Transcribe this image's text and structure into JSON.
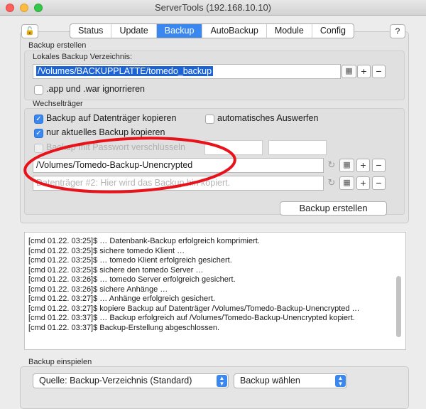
{
  "window": {
    "title": "ServerTools (192.168.10.10)"
  },
  "toolbar": {
    "lock_glyph": "🔓",
    "help_label": "?",
    "tabs": [
      {
        "label": "Status"
      },
      {
        "label": "Update"
      },
      {
        "label": "Backup",
        "active": true
      },
      {
        "label": "AutoBackup"
      },
      {
        "label": "Module"
      },
      {
        "label": "Config"
      }
    ]
  },
  "backup": {
    "section_label": "Backup erstellen",
    "local_dir_label": "Lokales Backup Verzeichnis:",
    "local_dir_value": "/Volumes/BACKUPPLATTE/tomedo_backup",
    "ignore_label": ".app und .war ignorrieren",
    "ignore_checked": false,
    "media_section_label": "Wechselträger",
    "copy_media_label": "Backup auf Datenträger kopieren",
    "copy_media_checked": true,
    "auto_eject_label": "automatisches Auswerfen",
    "auto_eject_checked": false,
    "current_only_label": "nur aktuelles Backup kopieren",
    "current_only_checked": true,
    "password_label": "Backup mit Passwort verschlüsseln",
    "password_checked": false,
    "media1_value": "/Volumes/Tomedo-Backup-Unencrypted",
    "media2_placeholder": "Datenträger #2: Hier wird das Backup hin kopiert.",
    "create_button": "Backup erstellen",
    "plus": "+",
    "minus": "−"
  },
  "log": {
    "lines": [
      "[cmd 01.22. 03:25]$ … Datenbank-Backup erfolgreich komprimiert.",
      "[cmd 01.22. 03:25]$ sichere tomedo Klient …",
      "[cmd 01.22. 03:25]$ … tomedo Klient erfolgreich gesichert.",
      "[cmd 01.22. 03:25]$ sichere den tomedo Server …",
      "[cmd 01.22. 03:26]$ … tomedo Server erfolgreich gesichert.",
      "[cmd 01.22. 03:26]$ sichere Anhänge …",
      "[cmd 01.22. 03:27]$ … Anhänge erfolgreich gesichert.",
      "[cmd 01.22. 03:27]$ kopiere Backup auf Datenträger /Volumes/Tomedo-Backup-Unencrypted …",
      "[cmd 01.22. 03:37]$ … Backup erfolgreich auf /Volumes/Tomedo-Backup-Unencrypted kopiert.",
      "[cmd 01.22. 03:37]$ Backup-Erstellung abgeschlossen."
    ]
  },
  "restore": {
    "section_label": "Backup einspielen",
    "source_value": "Quelle: Backup-Verzeichnis (Standard)",
    "choose_value": "Backup wählen"
  },
  "colors": {
    "accent": "#3b87f0",
    "annotation": "#e8121b"
  }
}
